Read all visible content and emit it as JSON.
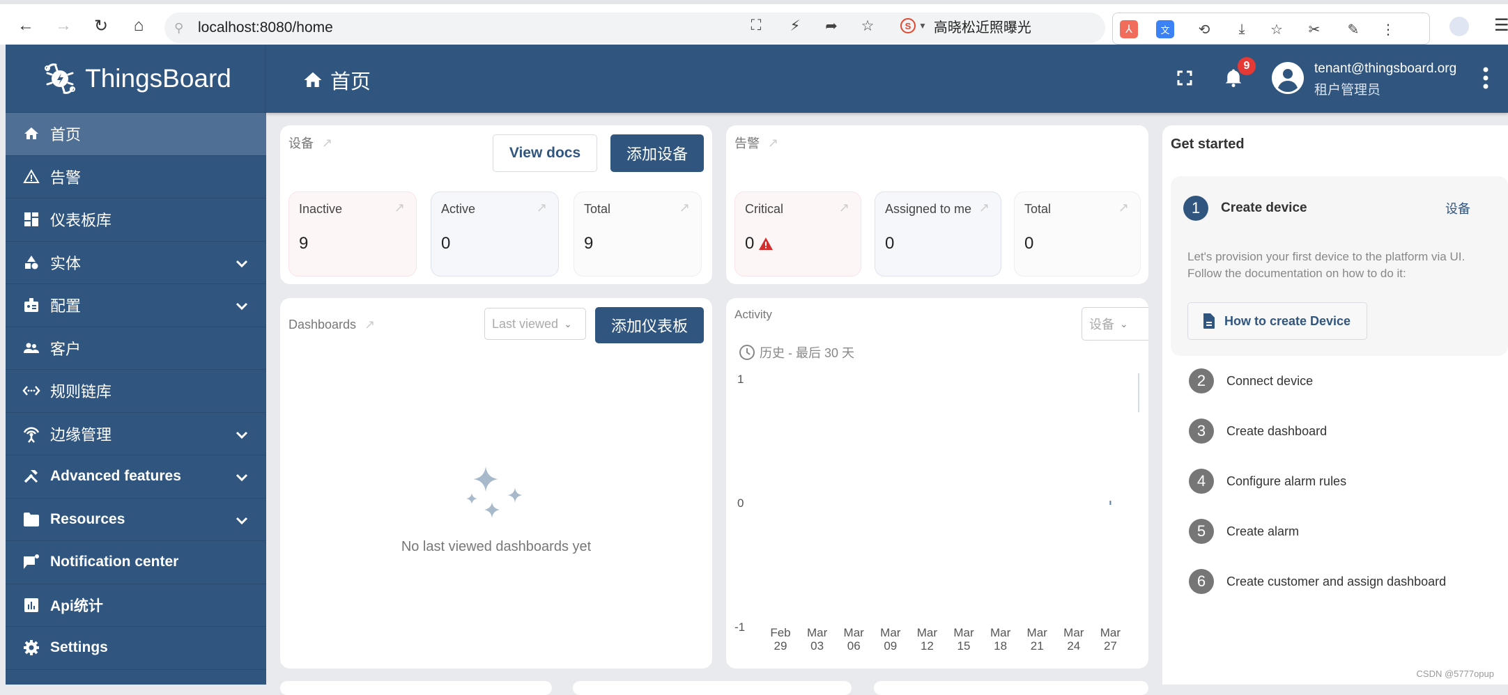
{
  "browser": {
    "url": "localhost:8080/home",
    "search_suggest": "高晓松近照曝光",
    "icons": [
      "back-icon",
      "forward-icon",
      "reload-icon",
      "home-icon",
      "translate-icon",
      "bolt-icon",
      "share-icon",
      "bookmark-add-icon",
      "sogou-icon"
    ],
    "extensions": [
      "pdf-icon",
      "translate-ext-icon",
      "history-icon",
      "download-icon",
      "star-icon",
      "scissors-icon",
      "sign-icon",
      "more-icon"
    ]
  },
  "app": {
    "brand": "ThingsBoard",
    "page_title": "首页",
    "notifications_count": "9",
    "user_email": "tenant@thingsboard.org",
    "user_role": "租户管理员",
    "colors": {
      "primary": "#305680",
      "active_nav": "#4f7094",
      "badge": "#e53935",
      "critical": "#d32f2f"
    }
  },
  "sidebar": {
    "items": [
      {
        "label": "首页",
        "icon": "home-icon",
        "active": true,
        "expandable": false
      },
      {
        "label": "告警",
        "icon": "warning-icon",
        "active": false,
        "expandable": false
      },
      {
        "label": "仪表板库",
        "icon": "dashboard-icon",
        "active": false,
        "expandable": false
      },
      {
        "label": "实体",
        "icon": "shapes-icon",
        "active": false,
        "expandable": true
      },
      {
        "label": "配置",
        "icon": "badge-icon",
        "active": false,
        "expandable": true
      },
      {
        "label": "客户",
        "icon": "people-icon",
        "active": false,
        "expandable": false
      },
      {
        "label": "规则链库",
        "icon": "settings-ethernet-icon",
        "active": false,
        "expandable": false
      },
      {
        "label": "边缘管理",
        "icon": "router-icon",
        "active": false,
        "expandable": true
      },
      {
        "label": "Advanced features",
        "icon": "construction-icon",
        "active": false,
        "expandable": true
      },
      {
        "label": "Resources",
        "icon": "folder-icon",
        "active": false,
        "expandable": true
      },
      {
        "label": "Notification center",
        "icon": "chat-notification-icon",
        "active": false,
        "expandable": false
      },
      {
        "label": "Api统计",
        "icon": "analytics-icon",
        "active": false,
        "expandable": false
      },
      {
        "label": "Settings",
        "icon": "gear-icon",
        "active": false,
        "expandable": false
      }
    ]
  },
  "devices": {
    "title": "设备",
    "view_docs": "View docs",
    "add_button": "添加设备",
    "stats": [
      {
        "label": "Inactive",
        "value": "9"
      },
      {
        "label": "Active",
        "value": "0"
      },
      {
        "label": "Total",
        "value": "9"
      }
    ]
  },
  "alarms": {
    "title": "告警",
    "stats": [
      {
        "label": "Critical",
        "value": "0"
      },
      {
        "label": "Assigned to me",
        "value": "0"
      },
      {
        "label": "Total",
        "value": "0"
      }
    ]
  },
  "dashboards": {
    "title": "Dashboards",
    "filter_value": "Last viewed",
    "add_button": "添加仪表板",
    "empty_text": "No last viewed dashboards yet"
  },
  "activity": {
    "title": "Activity",
    "entity_select": "设备",
    "timewindow": "历史 - 最后 30 天"
  },
  "chart_data": {
    "type": "line",
    "title": "Activity",
    "xlabel": "",
    "ylabel": "",
    "ylim": [
      -1,
      1
    ],
    "yticks": [
      "1",
      "0",
      "-1"
    ],
    "categories": [
      "Feb 29",
      "Mar 03",
      "Mar 06",
      "Mar 09",
      "Mar 12",
      "Mar 15",
      "Mar 18",
      "Mar 21",
      "Mar 24",
      "Mar 27"
    ],
    "series": [
      {
        "name": "设备",
        "values": [
          0,
          0,
          0,
          0,
          0,
          0,
          0,
          0,
          0,
          0
        ]
      }
    ],
    "grid": false,
    "legend": "none"
  },
  "get_started": {
    "title": "Get started",
    "steps": [
      {
        "num": "1",
        "label": "Create device",
        "link": "设备",
        "expanded": true,
        "description": "Let's provision your first device to the platform via UI. Follow the documentation on how to do it:",
        "doc_button": "How to create Device"
      },
      {
        "num": "2",
        "label": "Connect device"
      },
      {
        "num": "3",
        "label": "Create dashboard"
      },
      {
        "num": "4",
        "label": "Configure alarm rules"
      },
      {
        "num": "5",
        "label": "Create alarm"
      },
      {
        "num": "6",
        "label": "Create customer and assign dashboard"
      }
    ]
  },
  "watermark": "CSDN @5777opup"
}
